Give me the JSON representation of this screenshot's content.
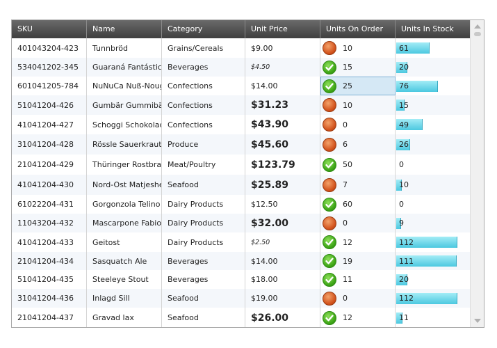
{
  "columns": [
    "SKU",
    "Name",
    "Category",
    "Unit Price",
    "Units On Order",
    "Units In Stock"
  ],
  "rows": [
    {
      "sku": "401043204-423",
      "name": "Tunnbröd",
      "category": "Grains/Cereals",
      "price": "$9.00",
      "price_style": "normal",
      "order_status": "warning",
      "on_order": "10",
      "in_stock": 61
    },
    {
      "sku": "534041202-345",
      "name": "Guaraná Fantástica",
      "category": "Beverages",
      "price": "$4.50",
      "price_style": "small",
      "order_status": "ok",
      "on_order": "15",
      "in_stock": 20
    },
    {
      "sku": "601041205-784",
      "name": "NuNuCa Nuß-Nougat-Creme",
      "category": "Confections",
      "price": "$14.00",
      "price_style": "normal",
      "order_status": "ok",
      "on_order": "25",
      "in_stock": 76
    },
    {
      "sku": "51041204-426",
      "name": "Gumbär Gummibärchen",
      "category": "Confections",
      "price": "$31.23",
      "price_style": "big",
      "order_status": "warning",
      "on_order": "10",
      "in_stock": 15
    },
    {
      "sku": "41041204-427",
      "name": "Schoggi Schokolade",
      "category": "Confections",
      "price": "$43.90",
      "price_style": "big",
      "order_status": "warning",
      "on_order": "0",
      "in_stock": 49
    },
    {
      "sku": "31041204-428",
      "name": "Rössle Sauerkraut",
      "category": "Produce",
      "price": "$45.60",
      "price_style": "big",
      "order_status": "warning",
      "on_order": "6",
      "in_stock": 26
    },
    {
      "sku": "21041204-429",
      "name": "Thüringer Rostbratwurst",
      "category": "Meat/Poultry",
      "price": "$123.79",
      "price_style": "big",
      "order_status": "ok",
      "on_order": "50",
      "in_stock": 0
    },
    {
      "sku": "41041204-430",
      "name": "Nord-Ost Matjeshering",
      "category": "Seafood",
      "price": "$25.89",
      "price_style": "big",
      "order_status": "warning",
      "on_order": "7",
      "in_stock": 10
    },
    {
      "sku": "61022204-431",
      "name": "Gorgonzola Telino",
      "category": "Dairy Products",
      "price": "$12.50",
      "price_style": "normal",
      "order_status": "ok",
      "on_order": "60",
      "in_stock": 0
    },
    {
      "sku": "11043204-432",
      "name": "Mascarpone Fabioli",
      "category": "Dairy Products",
      "price": "$32.00",
      "price_style": "big",
      "order_status": "warning",
      "on_order": "0",
      "in_stock": 9
    },
    {
      "sku": "41041204-433",
      "name": "Geitost",
      "category": "Dairy Products",
      "price": "$2.50",
      "price_style": "small",
      "order_status": "ok",
      "on_order": "12",
      "in_stock": 112
    },
    {
      "sku": "21041204-434",
      "name": "Sasquatch Ale",
      "category": "Beverages",
      "price": "$14.00",
      "price_style": "normal",
      "order_status": "ok",
      "on_order": "19",
      "in_stock": 111
    },
    {
      "sku": "51041204-435",
      "name": "Steeleye Stout",
      "category": "Beverages",
      "price": "$18.00",
      "price_style": "normal",
      "order_status": "ok",
      "on_order": "11",
      "in_stock": 20
    },
    {
      "sku": "31041204-436",
      "name": "Inlagd Sill",
      "category": "Seafood",
      "price": "$19.00",
      "price_style": "normal",
      "order_status": "warning",
      "on_order": "0",
      "in_stock": 112
    },
    {
      "sku": "21041204-437",
      "name": "Gravad lax",
      "category": "Seafood",
      "price": "$26.00",
      "price_style": "big",
      "order_status": "ok",
      "on_order": "12",
      "in_stock": 11
    }
  ],
  "selected_cell": {
    "row": 2,
    "column": "Units On Order"
  },
  "stock_max": 120,
  "colors": {
    "header": "#4f4f4f",
    "ok": "#3da516",
    "warning": "#d2521c",
    "stock_bar": "#6fd6ea",
    "selection": "#d5e8f5"
  },
  "icons": {
    "ok": "checkmark-icon",
    "warning": "warning-circle-icon"
  }
}
